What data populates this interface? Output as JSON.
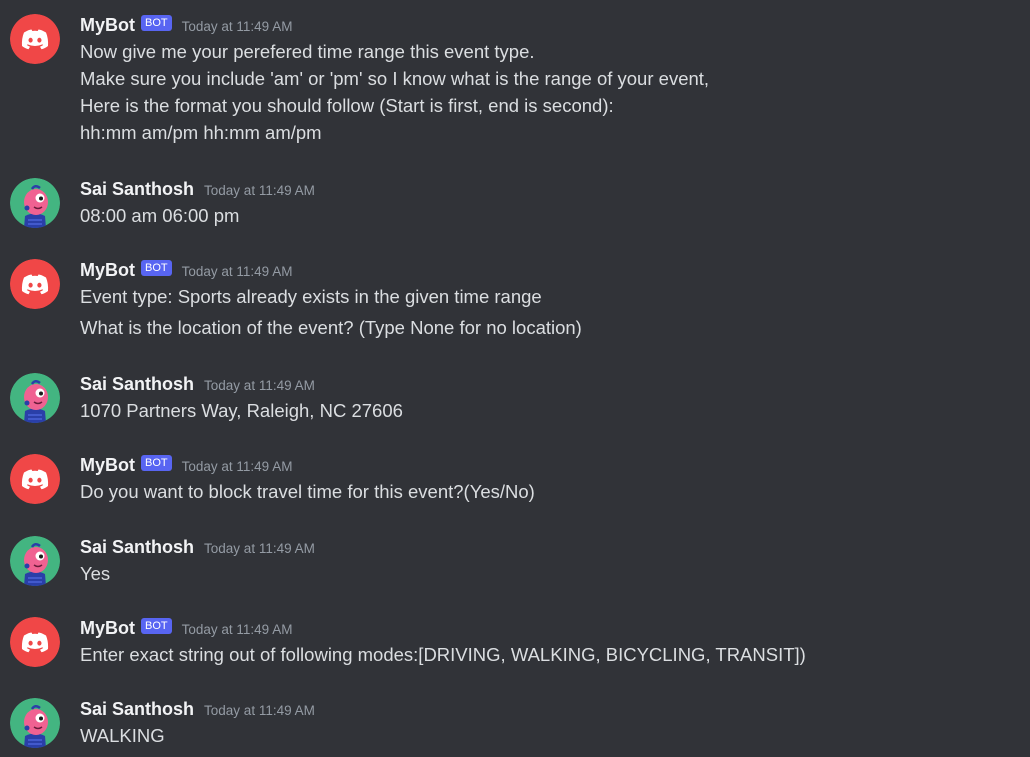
{
  "bot_name": "MyBot",
  "bot_tag": "BOT",
  "user_name": "Sai Santhosh",
  "timestamp": "Today at 11:49 AM",
  "colors": {
    "background": "#313338",
    "bot_avatar": "#f04747",
    "user_avatar": "#43b581",
    "bot_tag": "#5865f2"
  },
  "messages": [
    {
      "author": "MyBot",
      "is_bot": true,
      "avatar_icon": "discord-logo-icon",
      "lines": [
        "Now give me your perefered time range this event type.",
        "Make sure you include 'am' or 'pm' so I know what is the range of your event,",
        "Here is the format you should follow (Start is first, end is second):",
        "hh:mm am/pm hh:mm am/pm"
      ]
    },
    {
      "author": "Sai Santhosh",
      "is_bot": false,
      "avatar_icon": "creature-avatar-icon",
      "lines": [
        "08:00 am 06:00 pm"
      ]
    },
    {
      "author": "MyBot",
      "is_bot": true,
      "avatar_icon": "discord-logo-icon",
      "lines": [
        "Event type: Sports already exists in the given time range",
        "What is the location of the event? (Type None for no location)"
      ]
    },
    {
      "author": "Sai Santhosh",
      "is_bot": false,
      "avatar_icon": "creature-avatar-icon",
      "lines": [
        "1070 Partners Way, Raleigh, NC 27606"
      ]
    },
    {
      "author": "MyBot",
      "is_bot": true,
      "avatar_icon": "discord-logo-icon",
      "lines": [
        "Do you want to block travel time for this event?(Yes/No)"
      ]
    },
    {
      "author": "Sai Santhosh",
      "is_bot": false,
      "avatar_icon": "creature-avatar-icon",
      "lines": [
        "Yes"
      ]
    },
    {
      "author": "MyBot",
      "is_bot": true,
      "avatar_icon": "discord-logo-icon",
      "lines": [
        "Enter exact string out of following modes:[DRIVING, WALKING, BICYCLING, TRANSIT])"
      ]
    },
    {
      "author": "Sai Santhosh",
      "is_bot": false,
      "avatar_icon": "creature-avatar-icon",
      "lines": [
        "WALKING"
      ]
    }
  ]
}
